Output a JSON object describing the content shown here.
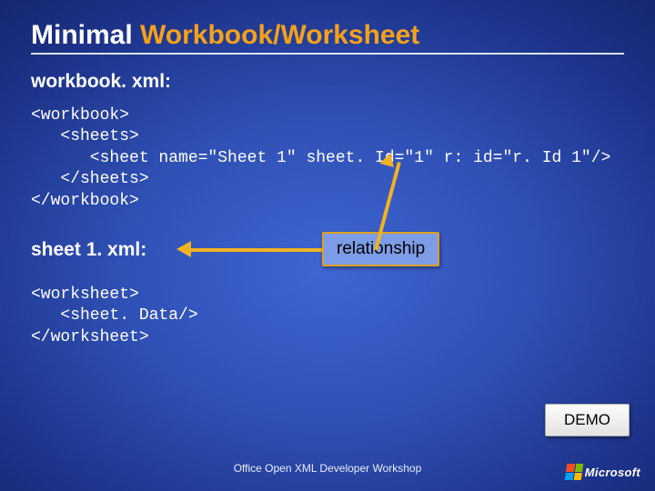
{
  "title_prefix": "Minimal ",
  "title_accent": "Workbook/Worksheet",
  "subheading1": "workbook. xml:",
  "code1": "<workbook>\n   <sheets>\n      <sheet name=\"Sheet 1\" sheet. Id=\"1\" r: id=\"r. Id 1\"/>\n   </sheets>\n</workbook>",
  "subheading2": "sheet 1. xml:",
  "relationship_label": "relationship",
  "code2": "<worksheet>\n   <sheet. Data/>\n</worksheet>",
  "demo_label": "DEMO",
  "footer_text": "Office Open XML Developer Workshop",
  "logo_text": "Microsoft"
}
